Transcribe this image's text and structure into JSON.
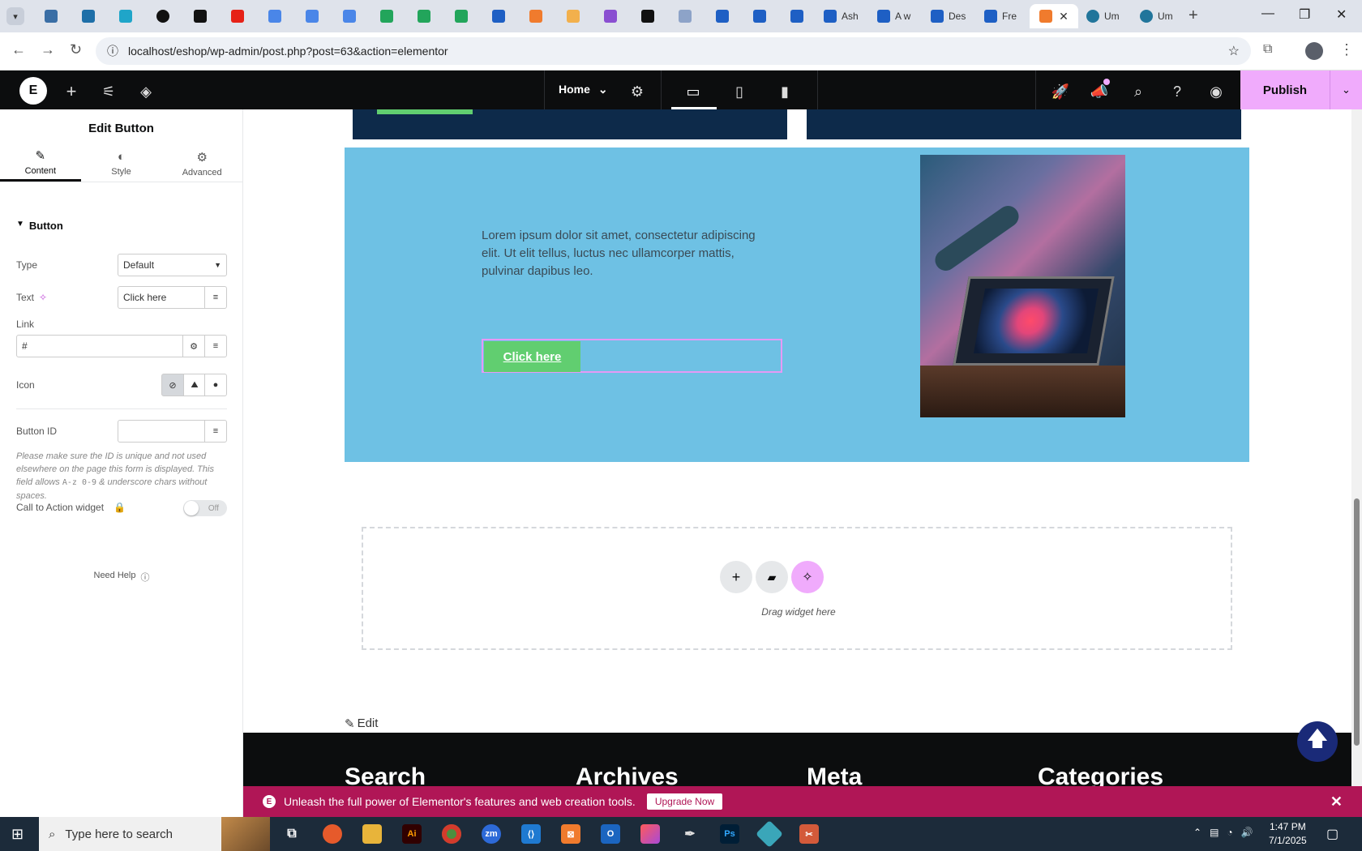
{
  "browser": {
    "tab_labels": [
      "Ash",
      "A w",
      "Des",
      "Fre",
      "Um",
      "Um"
    ],
    "url": "localhost/eshop/wp-admin/post.php?post=63&action=elementor"
  },
  "elementor_bar": {
    "page_name": "Home",
    "publish_label": "Publish"
  },
  "panel": {
    "title": "Edit Button",
    "tabs": [
      "Content",
      "Style",
      "Advanced"
    ],
    "section_title": "Button",
    "type_label": "Type",
    "type_value": "Default",
    "text_label": "Text",
    "text_value": "Click here",
    "link_label": "Link",
    "link_value": "#",
    "icon_label": "Icon",
    "button_id_label": "Button ID",
    "button_id_value": "",
    "note_pre": "Please make sure the ID is unique and not used elsewhere on the page this form is displayed. This field allows ",
    "note_code": "A-z 0-9",
    "note_post": " & underscore chars without spaces.",
    "cta_label": "Call to Action widget",
    "cta_toggle": "Off",
    "need_help": "Need Help"
  },
  "canvas": {
    "lorem": "Lorem ipsum dolor sit amet, consectetur adipiscing elit. Ut elit tellus, luctus nec ullamcorper mattis, pulvinar dapibus leo.",
    "button_text": "Click here",
    "drag_text": "Drag widget here",
    "edit_link": "Edit",
    "footer_headings": [
      "Search",
      "Archives",
      "Meta",
      "Categories"
    ]
  },
  "notice": {
    "text": "Unleash the full power of Elementor's features and web creation tools.",
    "button": "Upgrade Now"
  },
  "taskbar": {
    "search_placeholder": "Type here to search",
    "time": "1:47 PM",
    "date": "7/1/2025"
  },
  "colors": {
    "accent_pink": "#f0abfc",
    "section_blue": "#6ec1e4",
    "button_green": "#61ce70",
    "notice_red": "#b01656"
  }
}
